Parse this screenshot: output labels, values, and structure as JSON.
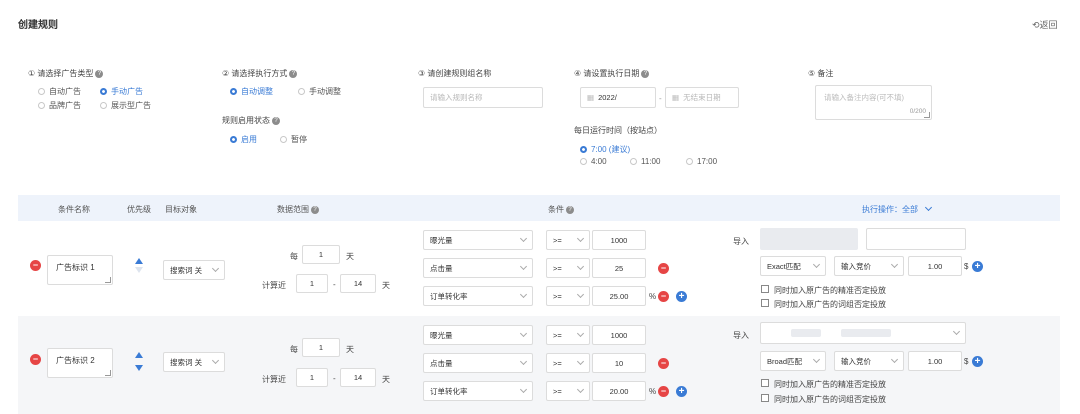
{
  "header": {
    "title": "创建规则",
    "back": "返回"
  },
  "form": {
    "ad_type": {
      "label": "① 请选择广告类型",
      "options": [
        "自动广告",
        "手动广告",
        "品牌广告",
        "展示型广告"
      ],
      "selected": "手动广告"
    },
    "exec_mode": {
      "label": "② 请选择执行方式",
      "options": [
        "自动调整",
        "手动调整"
      ],
      "selected": "自动调整"
    },
    "rule_status": {
      "label": "规则启用状态",
      "options": [
        "启用",
        "暂停"
      ],
      "selected": "启用"
    },
    "rule_group": {
      "label": "③ 请创建规则组名称",
      "placeholder": "请输入规则名称"
    },
    "exec_date": {
      "label": "④ 请设置执行日期",
      "start": "2022/",
      "end": "无结束日期",
      "separator": "-"
    },
    "daily_time": {
      "label": "每日运行时间（按站点）",
      "options": [
        "7:00 (建议)",
        "4:00",
        "11:00",
        "17:00"
      ],
      "selected": "7:00 (建议)"
    },
    "remark": {
      "label": "⑤ 备注",
      "placeholder": "请输入备注内容(可不填)",
      "counter": "0/200"
    }
  },
  "table": {
    "headers": {
      "name": "条件名称",
      "priority": "优先级",
      "target": "目标对象",
      "range": "数据范围",
      "condition": "条件",
      "action": "执行操作：全部"
    },
    "rows": [
      {
        "name": "广告标识 1",
        "target": "搜索词 关",
        "every_label": "每",
        "every_value": "1",
        "day_unit": "天",
        "calc_label": "计算近",
        "calc_from": "1",
        "calc_to": "14",
        "calc_unit": "天",
        "dash": "-",
        "conditions": [
          {
            "metric": "曝光量",
            "op": ">=",
            "value": "1000",
            "suffix": ""
          },
          {
            "metric": "点击量",
            "op": ">=",
            "value": "25",
            "suffix": ""
          },
          {
            "metric": "订单转化率",
            "op": ">=",
            "value": "25.00",
            "suffix": "%"
          }
        ],
        "action": {
          "label": "导入",
          "match": "Exact匹配",
          "bid_type": "输入竞价",
          "bid": "1.00",
          "currency": "$",
          "opt1": "同时加入原广告的精准否定投放",
          "opt2": "同时加入原广告的词组否定投放"
        }
      },
      {
        "name": "广告标识 2",
        "target": "搜索词 关",
        "every_label": "每",
        "every_value": "1",
        "day_unit": "天",
        "calc_label": "计算近",
        "calc_from": "1",
        "calc_to": "14",
        "calc_unit": "天",
        "dash": "-",
        "conditions": [
          {
            "metric": "曝光量",
            "op": ">=",
            "value": "1000",
            "suffix": ""
          },
          {
            "metric": "点击量",
            "op": ">=",
            "value": "10",
            "suffix": ""
          },
          {
            "metric": "订单转化率",
            "op": ">=",
            "value": "20.00",
            "suffix": "%"
          }
        ],
        "action": {
          "label": "导入",
          "match": "Broad匹配",
          "bid_type": "输入竞价",
          "bid": "1.00",
          "currency": "$",
          "opt1": "同时加入原广告的精准否定投放",
          "opt2": "同时加入原广告的词组否定投放"
        }
      }
    ]
  },
  "symbols": {
    "help": "?",
    "minus": "−",
    "plus": "+",
    "back_arrow": "⟲"
  },
  "colors": {
    "accent": "#3a7bd5",
    "danger": "#e64545",
    "header_bg": "#eef3fb"
  }
}
